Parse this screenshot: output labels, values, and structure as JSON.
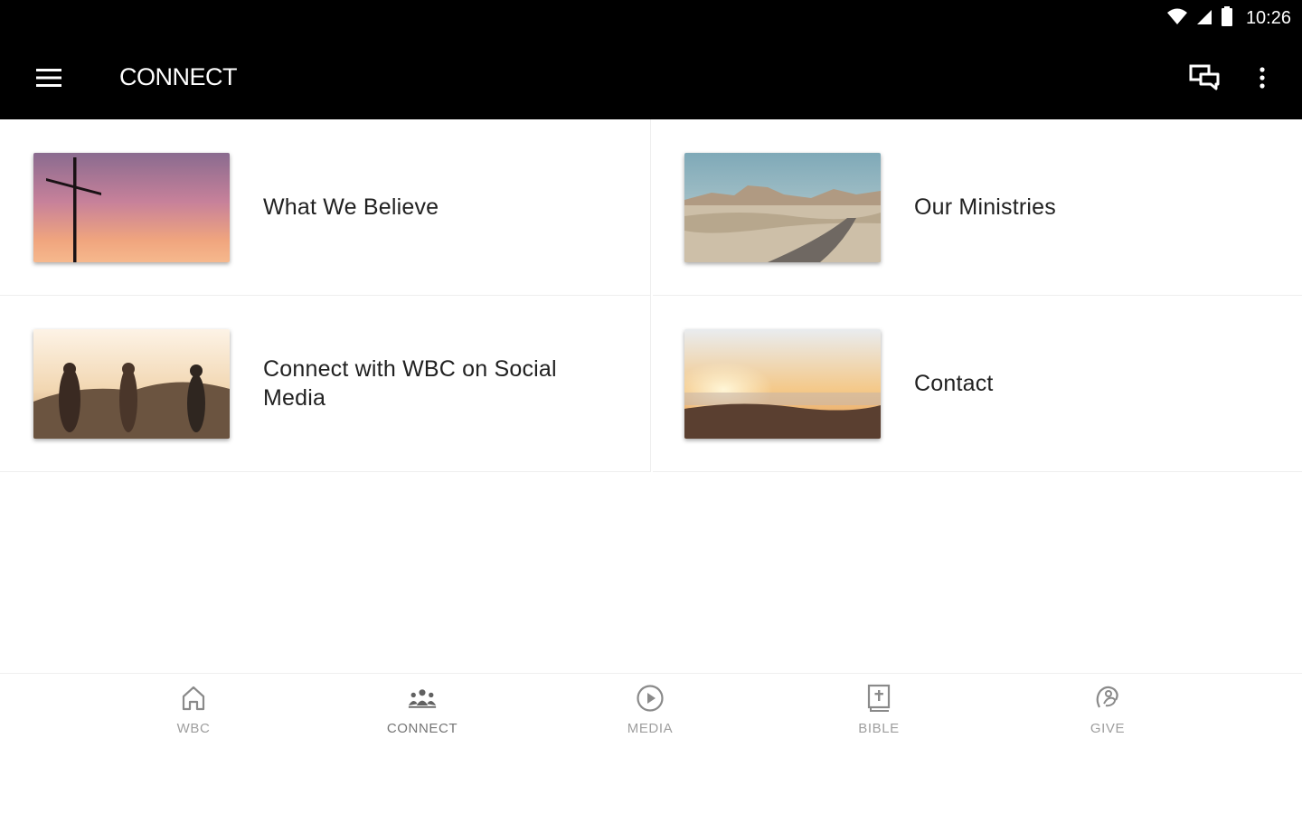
{
  "status_bar": {
    "time": "10:26"
  },
  "app_bar": {
    "title": "CONNECT"
  },
  "cards": [
    {
      "label": "What We Believe",
      "image": "cross-at-sunset"
    },
    {
      "label": "Our Ministries",
      "image": "desert-road"
    },
    {
      "label": "Connect with WBC on Social Media",
      "image": "people-on-hill-at-sunset"
    },
    {
      "label": "Contact",
      "image": "sunrise-over-clouds"
    }
  ],
  "bottom_nav": {
    "active": "CONNECT",
    "items": [
      {
        "label": "WBC",
        "icon": "home-icon"
      },
      {
        "label": "CONNECT",
        "icon": "people-icon"
      },
      {
        "label": "MEDIA",
        "icon": "play-circle-icon"
      },
      {
        "label": "BIBLE",
        "icon": "bible-icon"
      },
      {
        "label": "GIVE",
        "icon": "give-icon"
      }
    ]
  },
  "colors": {
    "app_bar": "#000000",
    "background": "#ffffff",
    "nav_label": "#9e9e9e"
  }
}
